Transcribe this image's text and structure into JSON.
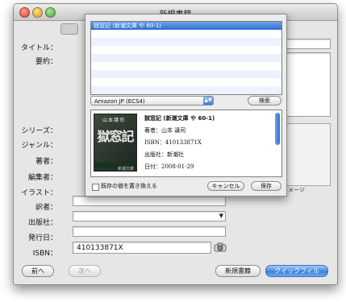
{
  "window": {
    "title": "新規書籍"
  },
  "form": {
    "labels": {
      "title": "タイトル：",
      "summary": "要約：",
      "series": "シリーズ：",
      "genre": "ジャンル：",
      "author": "著者：",
      "editor": "編集者：",
      "illustrator": "イラスト：",
      "translator": "訳者：",
      "publisher": "出版社：",
      "pubdate": "発行日：",
      "isbn": "ISBN："
    },
    "isbn_value": "410133871X",
    "image_label": "イメージ"
  },
  "sheet": {
    "results": [
      "獄窓記 (新潮文庫 や 60-1)"
    ],
    "source": "Amazon JP (ECS4)",
    "search_label": "検索",
    "detail": {
      "title": "獄窓記 (新潮文庫 や 60-1)",
      "author": "著者：山本 譲司",
      "isbn": "ISBN：410133871X",
      "publisher": "出版社：新潮社",
      "date": "日付：2008-01-29"
    },
    "cover": {
      "top": "山本譲司",
      "big": "獄窓記",
      "pub": "新潮文庫"
    },
    "overwrite_label": "既存の値を置き換える",
    "cancel_label": "キャンセル",
    "save_label": "保存"
  },
  "footer": {
    "prev_label": "前へ",
    "next_label": "次へ",
    "new_label": "新規書籍",
    "quickfill_label": "クイックフィル"
  }
}
